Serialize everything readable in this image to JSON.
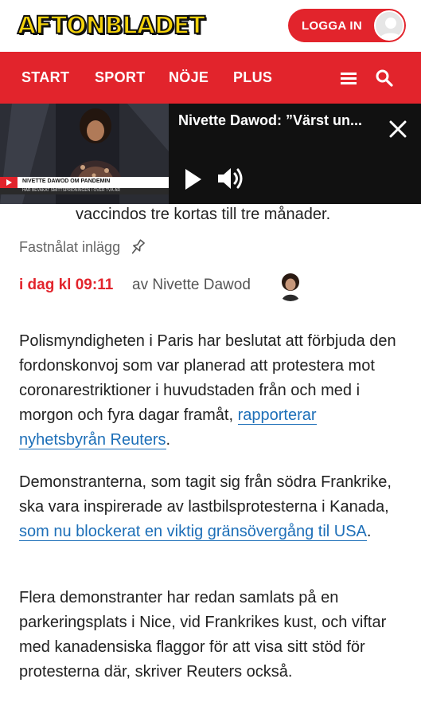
{
  "header": {
    "logo_text": "AFTONBLADET",
    "login_label": "LOGGA IN"
  },
  "nav": {
    "items": [
      "START",
      "SPORT",
      "NÖJE",
      "PLUS"
    ],
    "menu_icon": "menu-icon",
    "search_icon": "search-icon"
  },
  "player": {
    "title": "Nivette Dawod: ”Värst un...",
    "thumb_caption": "NIVETTE DAWOD OM PANDEMIN",
    "thumb_subcaption": "HAR BEVAKAT SMITTSPRIDNINGEN I ÖVER TVÅ ÅR"
  },
  "article": {
    "partial_line": "vaccindos tre kortas till tre månader.",
    "pinned_label": "Fastnålat inlägg",
    "time": "i dag kl 09:11",
    "author": "av Nivette Dawod",
    "p1_text": "Polismyndigheten i Paris har beslutat att förbjuda den fordonskonvoj som var planerad att protestera mot coronarestriktioner i huvudstaden från och med i morgon och fyra dagar framåt, ",
    "p1_link": "rapporterar nyhetsbyrån Reuters",
    "p1_end": ".",
    "p2_text": "Demonstranterna, som tagit sig från södra Frankrike, ska vara inspirerade av lastbilsprotesterna i Kanada, ",
    "p2_link": "som nu blockerat en viktig gränsövergång til USA",
    "p2_end": ".",
    "p3_text": "Flera demonstranter har redan samlats på en parkeringsplats i Nice, vid Frankrikes kust, och viftar med kanadensiska flaggor för att visa sitt stöd för protesterna där, skriver Reuters också."
  },
  "colors": {
    "brand_red": "#e2242c",
    "logo_yellow": "#f4d20a",
    "link_blue": "#1d6fb8"
  }
}
